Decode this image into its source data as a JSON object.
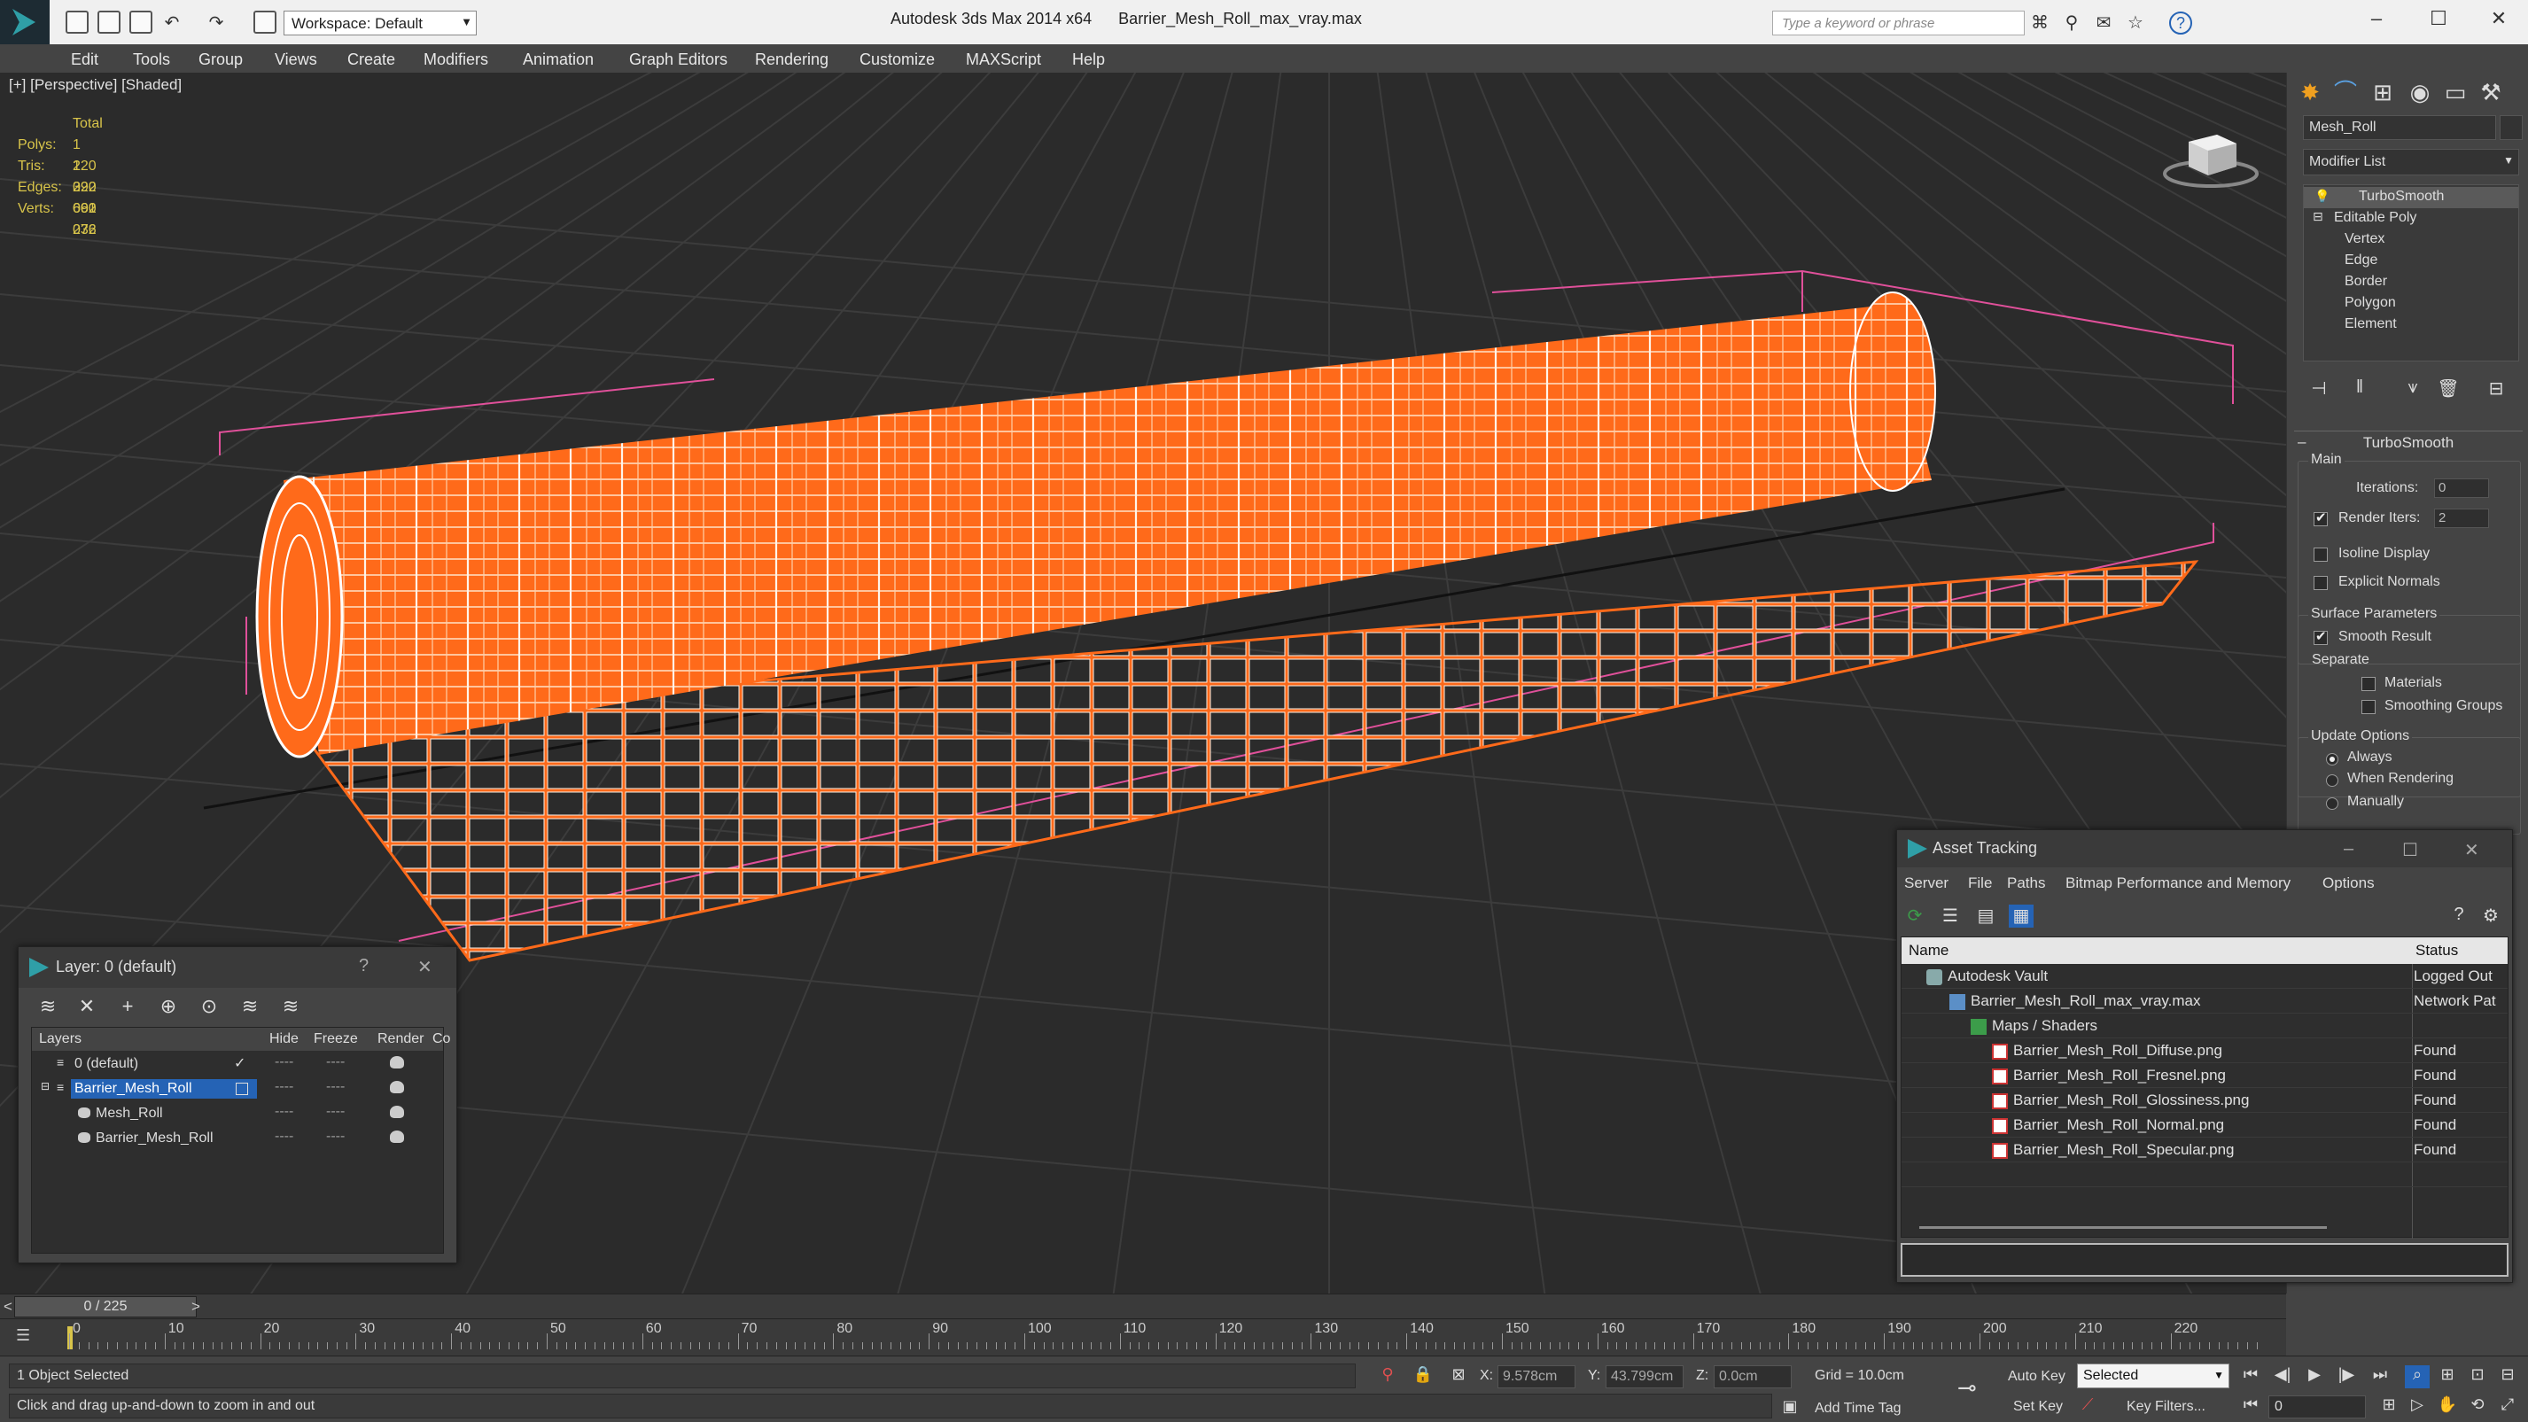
{
  "titlebar": {
    "app_title": "Autodesk 3ds Max  2014 x64",
    "file_name": "Barrier_Mesh_Roll_max_vray.max",
    "workspace": "Workspace: Default",
    "search_placeholder": "Type a keyword or phrase",
    "help_glyph": "?"
  },
  "menu": [
    "Edit",
    "Tools",
    "Group",
    "Views",
    "Create",
    "Modifiers",
    "Animation",
    "Graph Editors",
    "Rendering",
    "Customize",
    "MAXScript",
    "Help"
  ],
  "viewport": {
    "label": "[+] [Perspective] [Shaded]",
    "stats": {
      "total_label": "Total",
      "rows": [
        {
          "label": "Polys:",
          "value": "1 220 092"
        },
        {
          "label": "Tris:",
          "value": "1 220 092"
        },
        {
          "label": "Edges:",
          "value": "3 660 276"
        },
        {
          "label": "Verts:",
          "value": "601 032"
        }
      ]
    },
    "wire_color": "#ff6a1a",
    "bbox_color": "#e0509a"
  },
  "command_panel": {
    "object_name": "Mesh_Roll",
    "modifier_list": "Modifier List",
    "stack": [
      "TurboSmooth",
      "Editable Poly",
      "Vertex",
      "Edge",
      "Border",
      "Polygon",
      "Element"
    ],
    "rollout_title": "TurboSmooth",
    "main_label": "Main",
    "iterations_label": "Iterations:",
    "iterations_value": "0",
    "render_iters_label": "Render Iters:",
    "render_iters_value": "2",
    "isoline_label": "Isoline Display",
    "explicit_normals_label": "Explicit Normals",
    "surface_params_label": "Surface Parameters",
    "smooth_result_label": "Smooth Result",
    "separate_label": "Separate",
    "materials_label": "Materials",
    "smoothing_groups_label": "Smoothing Groups",
    "update_options_label": "Update Options",
    "update_always": "Always",
    "update_when_rendering": "When Rendering",
    "update_manually": "Manually"
  },
  "layer_dialog": {
    "title": "Layer: 0 (default)",
    "help": "?",
    "close": "✕",
    "columns": [
      "Layers",
      "Hide",
      "Freeze",
      "Render",
      "Co"
    ],
    "rows": [
      {
        "name": "0 (default)",
        "check": "✓"
      },
      {
        "name": "Barrier_Mesh_Roll"
      },
      {
        "name": "Mesh_Roll"
      },
      {
        "name": "Barrier_Mesh_Roll"
      }
    ],
    "dash": "----"
  },
  "asset_tracking": {
    "title": "Asset Tracking",
    "menu": [
      "Server",
      "File",
      "Paths",
      "Bitmap Performance and Memory",
      "Options"
    ],
    "columns": [
      "Name",
      "Status"
    ],
    "rows": [
      {
        "name": "Autodesk Vault",
        "status": "Logged Out"
      },
      {
        "name": "Barrier_Mesh_Roll_max_vray.max",
        "status": "Network Pat"
      },
      {
        "name": "Maps / Shaders",
        "status": ""
      },
      {
        "name": "Barrier_Mesh_Roll_Diffuse.png",
        "status": "Found"
      },
      {
        "name": "Barrier_Mesh_Roll_Fresnel.png",
        "status": "Found"
      },
      {
        "name": "Barrier_Mesh_Roll_Glossiness.png",
        "status": "Found"
      },
      {
        "name": "Barrier_Mesh_Roll_Normal.png",
        "status": "Found"
      },
      {
        "name": "Barrier_Mesh_Roll_Specular.png",
        "status": "Found"
      }
    ]
  },
  "timeline": {
    "frame_display": "0 / 225",
    "prev": "<",
    "next": ">",
    "ticks": [
      "0",
      "10",
      "20",
      "30",
      "40",
      "50",
      "60",
      "70",
      "80",
      "90",
      "100",
      "110",
      "120",
      "130",
      "140",
      "150",
      "160",
      "170",
      "180",
      "190",
      "200",
      "210",
      "220"
    ]
  },
  "status": {
    "selection": "1 Object Selected",
    "prompt": "Click and drag up-and-down to zoom in and out",
    "x_label": "X:",
    "x_value": "9.578cm",
    "y_label": "Y:",
    "y_value": "43.799cm",
    "z_label": "Z:",
    "z_value": "0.0cm",
    "grid": "Grid = 10.0cm",
    "add_time_tag": "Add Time Tag",
    "auto_key": "Auto Key",
    "set_key": "Set Key",
    "selected": "Selected",
    "key_filters": "Key Filters...",
    "frame": "0"
  }
}
